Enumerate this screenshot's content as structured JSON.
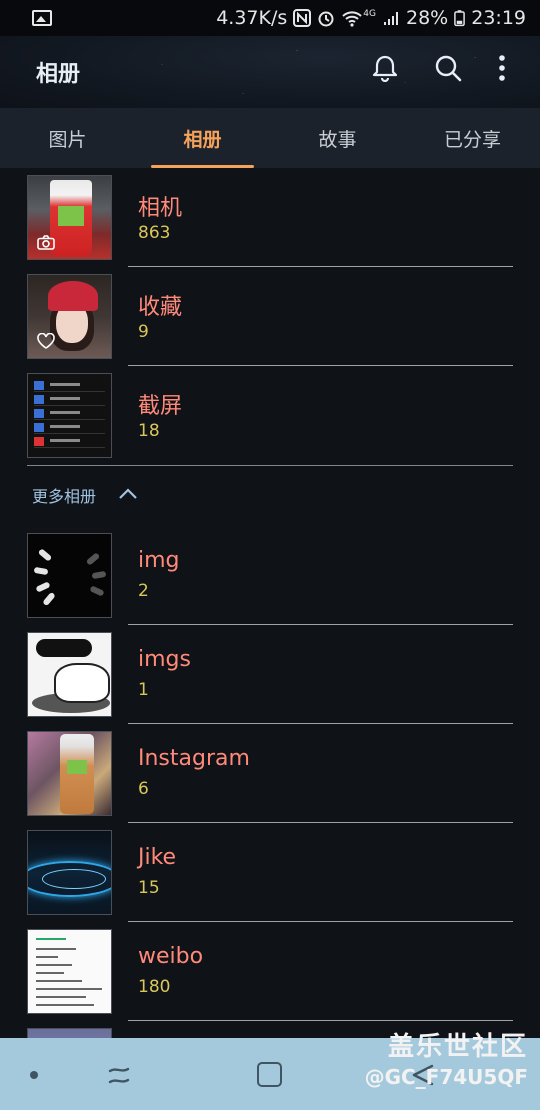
{
  "status_bar": {
    "speed": "4.37K/s",
    "network": "4G",
    "battery": "28%",
    "time": "23:19"
  },
  "header": {
    "title": "相册",
    "icons": [
      "bell-icon",
      "search-icon",
      "more-vert-icon"
    ]
  },
  "tabs": [
    {
      "label": "图片",
      "active": false
    },
    {
      "label": "相册",
      "active": true
    },
    {
      "label": "故事",
      "active": false
    },
    {
      "label": "已分享",
      "active": false
    }
  ],
  "albums": [
    {
      "name": "相机",
      "count": "863",
      "badge": "camera-icon"
    },
    {
      "name": "收藏",
      "count": "9",
      "badge": "heart-icon"
    },
    {
      "name": "截屏",
      "count": "18"
    }
  ],
  "more_albums": {
    "label": "更多相册",
    "expanded": true
  },
  "more_album_list": [
    {
      "name": "img",
      "count": "2"
    },
    {
      "name": "imgs",
      "count": "1"
    },
    {
      "name": "Instagram",
      "count": "6"
    },
    {
      "name": "Jike",
      "count": "15"
    },
    {
      "name": "weibo",
      "count": "180"
    }
  ],
  "watermark": {
    "line1": "盖乐世社区",
    "line2": "@GC_F74U5QF"
  },
  "colors": {
    "accent": "#f5a25a",
    "album_name": "#ff8a7a",
    "album_count": "#d8c85a",
    "nav_bar": "#a5c9dc"
  }
}
